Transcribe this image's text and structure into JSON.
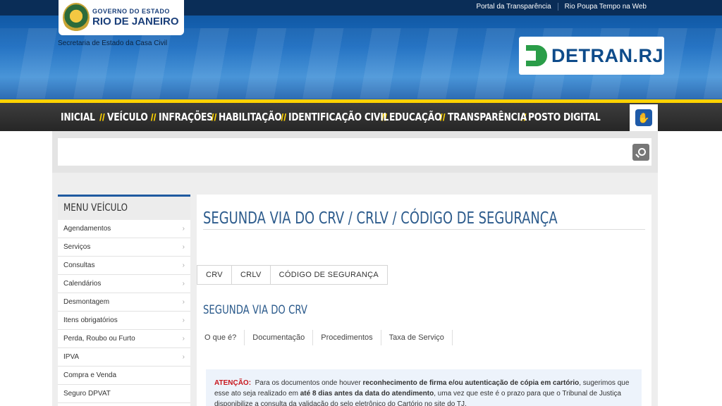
{
  "header": {
    "top_links": [
      "Portal da Transparência",
      "Rio Poupa Tempo na Web"
    ],
    "gov_logo_line1": "GOVERNO DO ESTADO",
    "gov_logo_line2": "RIO DE JANEIRO",
    "gov_subtitle": "Secretaria de Estado da Casa Civil",
    "detran_logo": "DETRAN.RJ"
  },
  "nav": {
    "items": [
      "INICIAL",
      "VEÍCULO",
      "INFRAÇÕES",
      "HABILITAÇÃO",
      "IDENTIFICAÇÃO CIVIL",
      "EDUCAÇÃO",
      "TRANSPARÊNCIA",
      "POSTO DIGITAL"
    ],
    "separator": "//"
  },
  "search": {
    "value": "",
    "placeholder": ""
  },
  "sidebar": {
    "title": "MENU VEÍCULO",
    "items": [
      {
        "label": "Agendamentos",
        "has_arrow": true
      },
      {
        "label": "Serviços",
        "has_arrow": true
      },
      {
        "label": "Consultas",
        "has_arrow": true
      },
      {
        "label": "Calendários",
        "has_arrow": true
      },
      {
        "label": "Desmontagem",
        "has_arrow": true
      },
      {
        "label": "Itens obrigatórios",
        "has_arrow": true
      },
      {
        "label": "Perda, Roubo ou Furto",
        "has_arrow": true
      },
      {
        "label": "IPVA",
        "has_arrow": true
      },
      {
        "label": "Compra e Venda",
        "has_arrow": false
      },
      {
        "label": "Seguro DPVAT",
        "has_arrow": false
      }
    ],
    "arrow_glyph": "›"
  },
  "main": {
    "title": "SEGUNDA VIA DO CRV / CRLV / CÓDIGO DE SEGURANÇA",
    "tabs": [
      "CRV",
      "CRLV",
      "CÓDIGO DE SEGURANÇA"
    ],
    "section_title": "SEGUNDA VIA DO CRV",
    "subtabs": [
      "O que é?",
      "Documentação",
      "Procedimentos",
      "Taxa de Serviço"
    ],
    "notice": {
      "label": "ATENÇÃO:",
      "t1": "Para os documentos onde houver ",
      "b1": "reconhecimento de firma e/ou autenticação de cópia em cartório",
      "t2": ", sugerimos que esse ato seja realizado em ",
      "b2": "até 8 dias antes da data do atendimento",
      "t3": ", uma vez que este é o prazo para que o Tribunal de Justiça disponibilize a consulta da validação do selo eletrônico do Cartório no site do TJ."
    }
  },
  "colors": {
    "header_blue": "#1a6cc0",
    "accent_yellow": "#ffd200",
    "title_blue": "#2c5b8c",
    "warning_red": "#c8161d",
    "detran_green": "#2a9d48"
  }
}
